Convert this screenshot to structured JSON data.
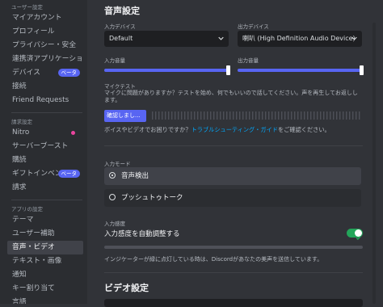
{
  "sidebar": {
    "sections": [
      {
        "title": "ユーザー設定",
        "items": [
          {
            "label": "マイアカウント"
          },
          {
            "label": "プロフィール"
          },
          {
            "label": "プライバシー・安全"
          },
          {
            "label": "連携済アプリケーション"
          },
          {
            "label": "デバイス",
            "badge": "ベータ"
          },
          {
            "label": "接続"
          },
          {
            "label": "Friend Requests"
          }
        ]
      },
      {
        "title": "請求設定",
        "items": [
          {
            "label": "Nitro",
            "dot": true
          },
          {
            "label": "サーバーブースト"
          },
          {
            "label": "購読"
          },
          {
            "label": "ギフトインベントリ",
            "badge": "ベータ"
          },
          {
            "label": "請求"
          }
        ]
      },
      {
        "title": "アプリの設定",
        "items": [
          {
            "label": "テーマ"
          },
          {
            "label": "ユーザー補助"
          },
          {
            "label": "音声・ビデオ",
            "active": true
          },
          {
            "label": "テキスト・画像"
          },
          {
            "label": "通知"
          },
          {
            "label": "キー割り当て"
          },
          {
            "label": "言語"
          }
        ]
      }
    ]
  },
  "voice": {
    "title": "音声設定",
    "input_device_label": "入力デバイス",
    "input_device_value": "Default",
    "output_device_label": "出力デバイス",
    "output_device_value": "喇叭 (High Definition Audio Device)",
    "input_volume_label": "入力音量",
    "input_volume": 1.0,
    "output_volume_label": "出力音量",
    "output_volume": 1.0,
    "mic_test_label": "マイクテスト",
    "mic_test_desc": "マイクに問題がありますか？テストを始め、何でもいいので話してください。声を再生してお返しします。",
    "check_button": "確認しまし...",
    "trouble_prefix": "ボイスやビデオでお困りですか？",
    "trouble_link": "トラブルシューティング・ガイド",
    "trouble_suffix": "をご確認ください。",
    "input_mode_label": "入力モード",
    "modes": [
      {
        "label": "音声検出",
        "selected": true
      },
      {
        "label": "プッシュトゥトーク",
        "selected": false
      }
    ],
    "sensitivity_label": "入力感度",
    "auto_sensitivity_label": "入力感度を自動調整する",
    "auto_sensitivity_on": true,
    "indicator_note": "インジケーターが緑に点灯している時は、Discordがあなたの美声を送信しています。"
  },
  "video": {
    "title": "ビデオ設定"
  },
  "colors": {
    "accent": "#5865f2",
    "link": "#00a8fc",
    "toggle_on": "#23a55a",
    "sidebar_bg": "#2b2d31",
    "main_bg": "#313338"
  },
  "icons": {
    "dropdown": "chevron-down-icon",
    "toggle_check": "check-icon",
    "nitro": "dot-icon"
  }
}
